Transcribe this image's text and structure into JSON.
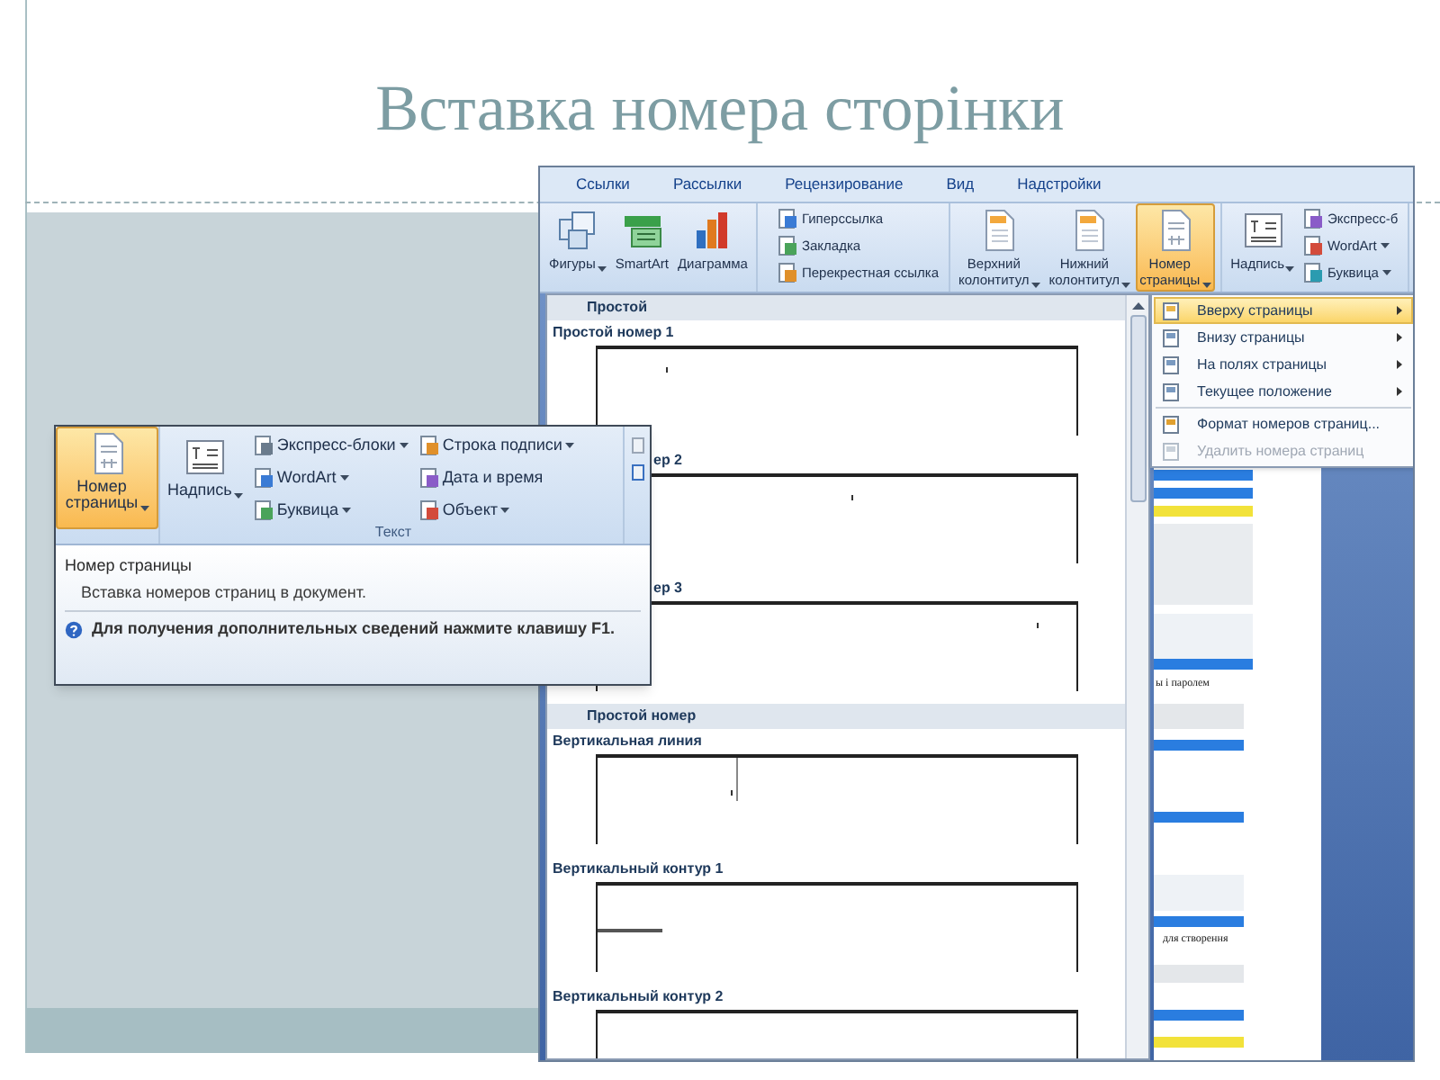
{
  "slide": {
    "title": "Вставка номера сторінки"
  },
  "word_window": {
    "tabs": [
      "Ссылки",
      "Рассылки",
      "Рецензирование",
      "Вид",
      "Надстройки"
    ],
    "ribbon_groups": [
      {
        "buttons": [
          {
            "label": "Фигуры",
            "kind": "large",
            "dropdown": true,
            "selected": false
          },
          {
            "label": "SmartArt",
            "kind": "large",
            "dropdown": false,
            "selected": false
          },
          {
            "label": "Диаграмма",
            "kind": "large",
            "dropdown": false,
            "selected": false
          }
        ]
      },
      {
        "buttons": [
          {
            "label": "Гиперссылка",
            "kind": "small",
            "dropdown": false,
            "selected": false
          },
          {
            "label": "Закладка",
            "kind": "small",
            "dropdown": false,
            "selected": false
          },
          {
            "label": "Перекрестная ссылка",
            "kind": "small",
            "dropdown": false,
            "selected": false
          }
        ]
      },
      {
        "buttons": [
          {
            "label": "Верхний\nколонтитул",
            "kind": "large",
            "dropdown": true,
            "selected": false
          },
          {
            "label": "Нижний\nколонтитул",
            "kind": "large",
            "dropdown": true,
            "selected": false
          },
          {
            "label": "Номер\nстраницы",
            "kind": "large",
            "dropdown": true,
            "selected": true
          }
        ]
      },
      {
        "buttons": [
          {
            "label": "Надпись",
            "kind": "large",
            "dropdown": true,
            "selected": false
          },
          {
            "label": "Экспресс-б",
            "kind": "small",
            "dropdown": false,
            "selected": false
          },
          {
            "label": "WordArt",
            "kind": "small",
            "dropdown": true,
            "selected": false
          },
          {
            "label": "Буквица",
            "kind": "small",
            "dropdown": true,
            "selected": false
          }
        ]
      }
    ],
    "gallery": [
      {
        "title": "Простой",
        "items": [
          {
            "label": "Простой номер 1",
            "kind": "left",
            "covered": false
          },
          {
            "label": "ер 2",
            "kind": "center",
            "covered": true
          },
          {
            "label": "ер 3",
            "kind": "right",
            "covered": true
          }
        ]
      },
      {
        "title": "Простой номер",
        "items": [
          {
            "label": "Вертикальная линия",
            "kind": "line",
            "covered": false
          },
          {
            "label": "Вертикальный контур 1",
            "kind": "contour",
            "covered": false
          },
          {
            "label": "Вертикальный контур 2",
            "kind": "blank",
            "covered": false
          }
        ]
      }
    ],
    "menu": [
      {
        "label": "Вверху страницы",
        "selected": true,
        "disabled": false,
        "submenu": true,
        "separator_before": false
      },
      {
        "label": "Внизу страницы",
        "selected": false,
        "disabled": false,
        "submenu": true,
        "separator_before": false
      },
      {
        "label": "На полях страницы",
        "selected": false,
        "disabled": false,
        "submenu": true,
        "separator_before": false
      },
      {
        "label": "Текущее положение",
        "selected": false,
        "disabled": false,
        "submenu": true,
        "separator_before": false
      },
      {
        "label": "Формат номеров страниц...",
        "selected": false,
        "disabled": false,
        "submenu": false,
        "separator_before": true
      },
      {
        "label": "Удалить номера страниц",
        "selected": false,
        "disabled": true,
        "submenu": false,
        "separator_before": false
      }
    ],
    "document_texts": [
      "ы і паролем",
      "для створення"
    ]
  },
  "inset": {
    "page_number_button": {
      "label": "Номер\nстраницы",
      "kind": "large",
      "dropdown": true,
      "selected": true
    },
    "text_group": {
      "buttons": [
        {
          "label": "Надпись",
          "kind": "large",
          "dropdown": true,
          "selected": false
        },
        {
          "label": "Экспресс-блоки",
          "kind": "small",
          "dropdown": true,
          "selected": false
        },
        {
          "label": "WordArt",
          "kind": "small",
          "dropdown": true,
          "selected": false
        },
        {
          "label": "Буквица",
          "kind": "small",
          "dropdown": true,
          "selected": false
        },
        {
          "label": "Строка подписи",
          "kind": "small",
          "dropdown": true,
          "selected": false
        },
        {
          "label": "Дата и время",
          "kind": "small",
          "dropdown": false,
          "selected": false
        },
        {
          "label": "Объект",
          "kind": "small",
          "dropdown": true,
          "selected": false
        }
      ],
      "label": "Текст"
    },
    "tooltip": {
      "title": "Номер страницы",
      "description": "Вставка номеров страниц в документ.",
      "help": "Для получения дополнительных сведений нажмите клавишу F1."
    }
  }
}
